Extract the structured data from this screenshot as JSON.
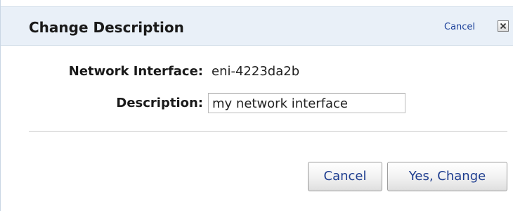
{
  "dialog": {
    "title": "Change Description",
    "header_cancel_label": "Cancel",
    "close_icon": "close-x-icon"
  },
  "fields": {
    "network_interface": {
      "label": "Network Interface:",
      "value": "eni-4223da2b"
    },
    "description": {
      "label": "Description:",
      "value": "my network interface"
    }
  },
  "actions": {
    "cancel_label": "Cancel",
    "confirm_label": "Yes, Change"
  },
  "colors": {
    "header_bg": "#e9f0f8",
    "link": "#1a3f99",
    "button_text": "#1e3d8f"
  }
}
